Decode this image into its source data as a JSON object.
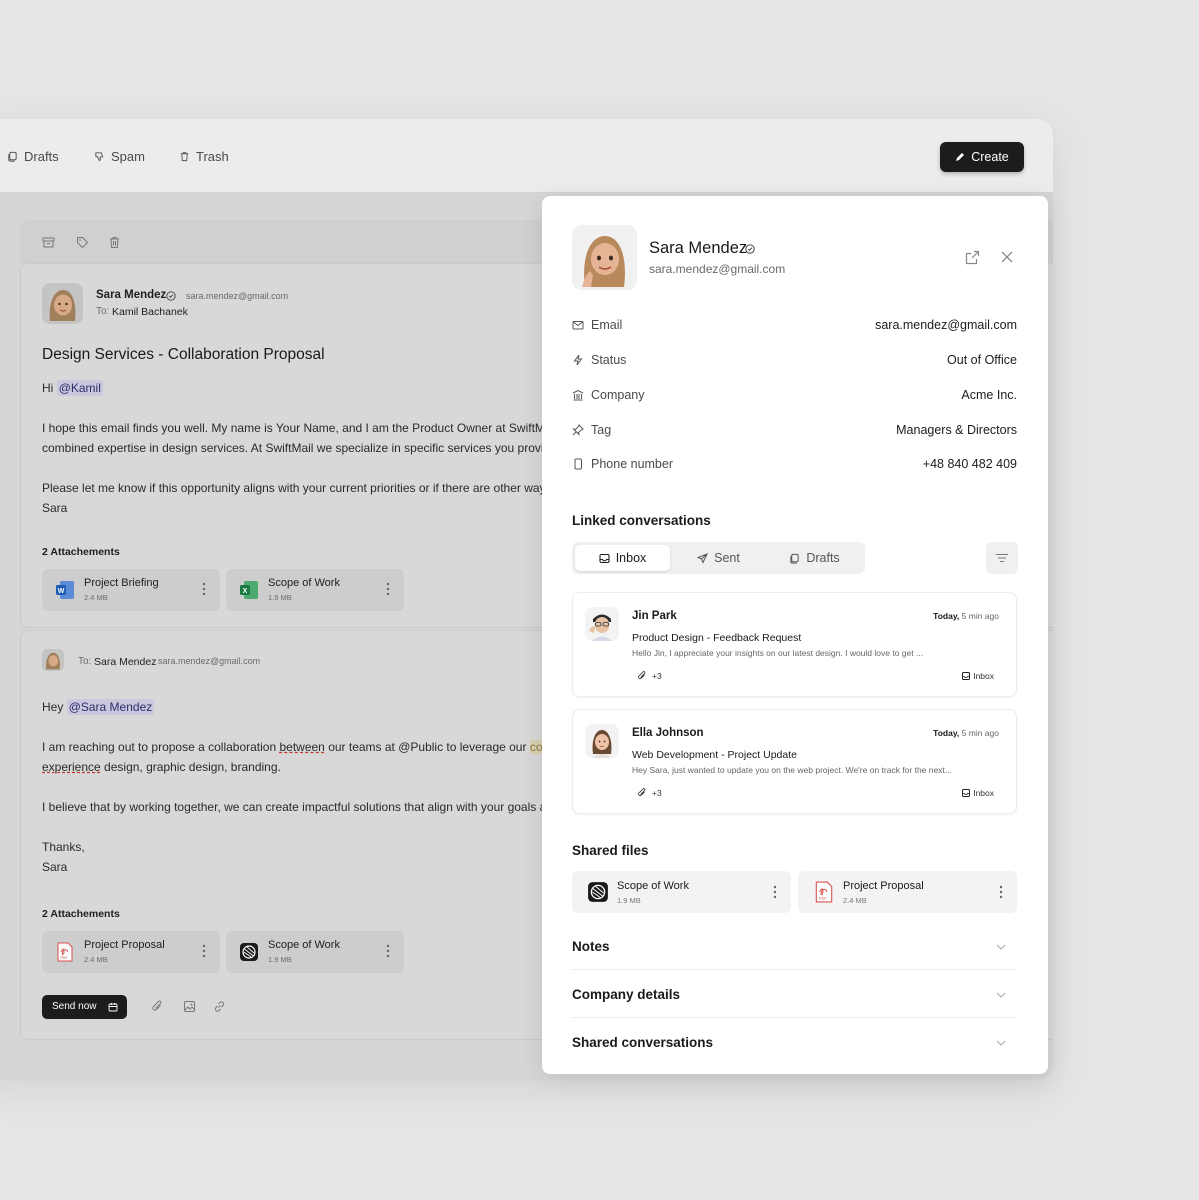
{
  "topbar": {
    "nav": [
      {
        "label": "Drafts",
        "icon": "drafts-icon"
      },
      {
        "label": "Spam",
        "icon": "thumbs-down-icon"
      },
      {
        "label": "Trash",
        "icon": "trash-icon"
      }
    ],
    "create_label": "Create"
  },
  "mail1": {
    "sender": "Sara Mendez",
    "sender_email": "sara.mendez@gmail.com",
    "to_label": "To:",
    "to_name": "Kamil Bachanek",
    "subject": "Design Services - Collaboration Proposal",
    "greeting": "Hi",
    "mention": "@Kamil",
    "para1_line1": "I hope this email finds you well. My name is Your Name, and I am the Product Owner at SwiftMail. I",
    "para1_line2": "combined expertise in design services. At SwiftMail we specialize in specific services you provide.",
    "para2": "Please let me know if this opportunity aligns with your current priorities or if there are other ways w",
    "signoff": "Sara",
    "attachments_title": "2 Attachements",
    "attachments": [
      {
        "name": "Project Briefing",
        "size": "2.4 MB",
        "icon": "word-file-icon"
      },
      {
        "name": "Scope of Work",
        "size": "1.9 MB",
        "icon": "excel-file-icon"
      }
    ]
  },
  "mail2": {
    "to_label": "To:",
    "to_name": "Sara Mendez",
    "to_email": "sara.mendez@gmail.com",
    "greeting": "Hey",
    "mention": "@Sara Mendez",
    "para1_a": "I am reaching out to propose a collaboration ",
    "para1_b": "between",
    "para1_c": " our teams at @Public to leverage our ",
    "para1_d": "combin",
    "para1_line2_a": "experience",
    "para1_line2_b": " design, graphic design, branding.",
    "para2": "I believe that by working together, we can create impactful solutions that align with your goals and",
    "thanks": "Thanks,",
    "signoff": "Sara",
    "attachments_title": "2 Attachements",
    "attachments": [
      {
        "name": "Project Proposal",
        "size": "2.4 MB",
        "icon": "pdf-file-icon"
      },
      {
        "name": "Scope of Work",
        "size": "1.9 MB",
        "icon": "scope-file-icon"
      }
    ],
    "send_label": "Send now"
  },
  "contact": {
    "name": "Sara Mendez",
    "email": "sara.mendez@gmail.com",
    "fields": [
      {
        "label": "Email",
        "value": "sara.mendez@gmail.com",
        "icon": "mail-icon"
      },
      {
        "label": "Status",
        "value": "Out of Office",
        "icon": "lightning-icon"
      },
      {
        "label": "Company",
        "value": "Acme Inc.",
        "icon": "building-icon"
      },
      {
        "label": "Tag",
        "value": "Managers & Directors",
        "icon": "pin-icon"
      },
      {
        "label": "Phone number",
        "value": "+48 840 482 409",
        "icon": "phone-icon"
      }
    ]
  },
  "linked": {
    "title": "Linked conversations",
    "tabs": [
      {
        "label": "Inbox",
        "icon": "inbox-icon"
      },
      {
        "label": "Sent",
        "icon": "send-icon"
      },
      {
        "label": "Drafts",
        "icon": "drafts-icon"
      }
    ],
    "conversations": [
      {
        "name": "Jin Park",
        "time_day": "Today,",
        "time_rel": "5 min ago",
        "subject": "Product Design - Feedback Request",
        "preview": "Hello Jin, I appreciate your insights on our latest design. I would love to get ...",
        "attachments": "+3",
        "tag": "Inbox"
      },
      {
        "name": "Ella Johnson",
        "time_day": "Today,",
        "time_rel": "5 min ago",
        "subject": "Web Development - Project Update",
        "preview": "Hey Sara, just wanted to update you on the web project. We're on track for the next...",
        "attachments": "+3",
        "tag": "Inbox"
      }
    ]
  },
  "shared_files": {
    "title": "Shared files",
    "files": [
      {
        "name": "Scope of Work",
        "size": "1.9 MB",
        "icon": "scope-file-icon"
      },
      {
        "name": "Project Proposal",
        "size": "2.4 MB",
        "icon": "pdf-file-icon"
      }
    ]
  },
  "sections": [
    "Notes",
    "Company details",
    "Shared conversations"
  ],
  "colors": {
    "accent_dark": "#1c1c1c",
    "mention_bg": "#c9c8de",
    "highlight_bg": "#d8d0b4"
  }
}
